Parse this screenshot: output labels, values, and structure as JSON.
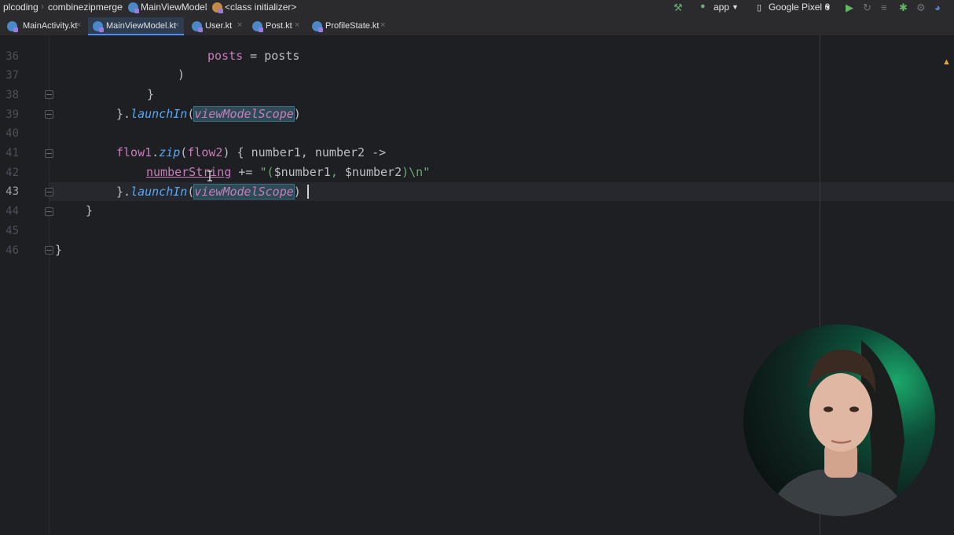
{
  "navbar": {
    "crumbs": [
      "plcoding",
      "combinezipmerge",
      "MainViewModel",
      "<class initializer>"
    ],
    "run_config": "app",
    "device": "Google Pixel 6",
    "icons": [
      "hammer-icon",
      "android-icon",
      "device-icon",
      "run-icon",
      "rerun-icon",
      "coverage-icon",
      "debug-icon",
      "profiler-icon",
      "analyzer-icon"
    ]
  },
  "tabs": [
    {
      "label": "MainActivity.kt",
      "active": false
    },
    {
      "label": "MainViewModel.kt",
      "active": true
    },
    {
      "label": "User.kt",
      "active": false
    },
    {
      "label": "Post.kt",
      "active": false
    },
    {
      "label": "ProfileState.kt",
      "active": false
    }
  ],
  "editor": {
    "line_numbers": [
      "36",
      "37",
      "38",
      "39",
      "40",
      "41",
      "42",
      "43",
      "44",
      "45",
      "46"
    ],
    "current_line": "43",
    "code": {
      "l36": {
        "a": "posts",
        "b": " = ",
        "c": "posts"
      },
      "l37": ")",
      "l38": "}",
      "l39": {
        "a": "}.",
        "fn": "launchIn",
        "b": "(",
        "scope": "viewModelScope",
        "c": ")"
      },
      "l41": {
        "prop1": "flow1",
        "dot": ".",
        "fn": "zip",
        "b": "(",
        "prop2": "flow2",
        "c": ") { number1, number2 ->"
      },
      "l42": {
        "prop": "numberString",
        "b": " += ",
        "str1": "\"(",
        "c": "$number1",
        "str2": ", ",
        "d": "$number2",
        "str3": ")\\n\""
      },
      "l43": {
        "a": "}.",
        "fn": "launchIn",
        "b": "(",
        "scope": "viewModelScope",
        "c": ")"
      },
      "l44": "}",
      "l46": "}"
    }
  },
  "colors": {
    "background": "#1e1f22",
    "keyword": "#cf8e6d",
    "function": "#56a8f5",
    "property": "#c77dbb",
    "string": "#6aab73",
    "accent": "#4c8ef7"
  }
}
